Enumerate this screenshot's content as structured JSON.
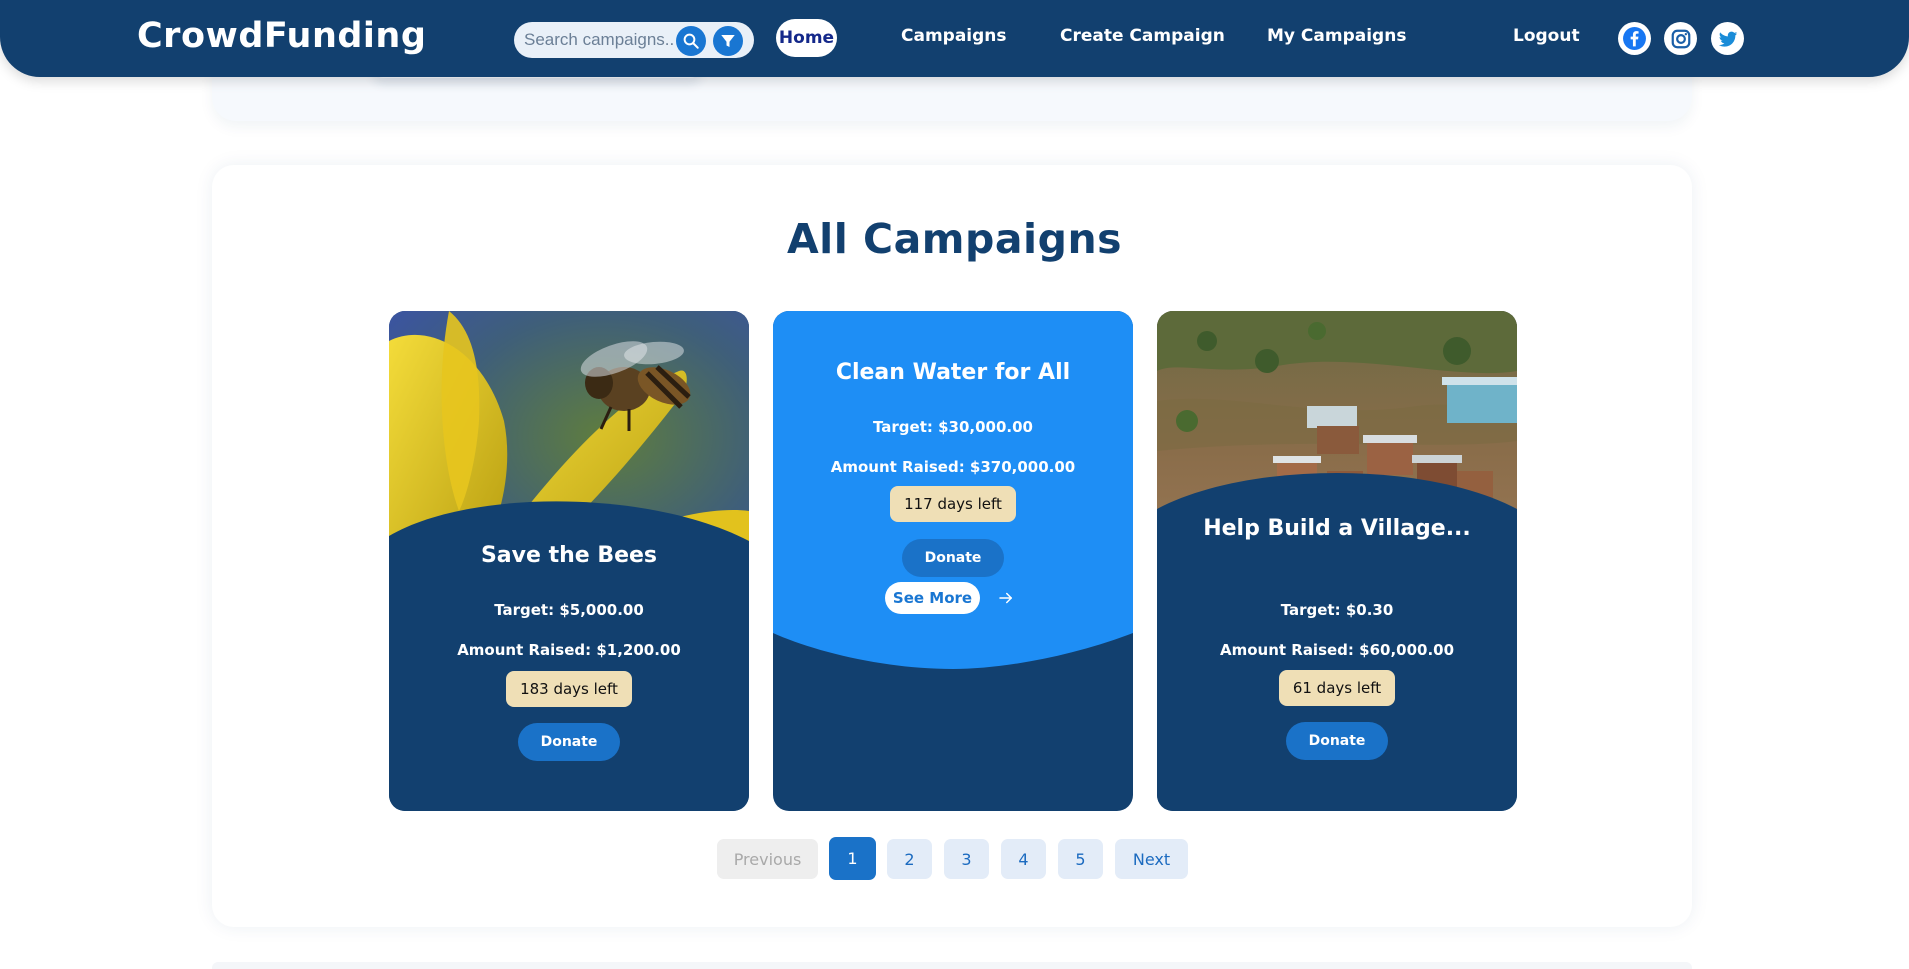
{
  "brand": "CrowdFunding",
  "search": {
    "placeholder": "Search campaigns..."
  },
  "nav": {
    "home": "Home",
    "campaigns": "Campaigns",
    "create": "Create Campaign",
    "my_campaigns": "My Campaigns",
    "logout": "Logout"
  },
  "social": [
    "facebook-icon",
    "instagram-icon",
    "twitter-icon"
  ],
  "section_title": "All Campaigns",
  "campaigns": [
    {
      "title": "Save the Bees",
      "target": "Target: $5,000.00",
      "raised": "Amount Raised: $1,200.00",
      "days": "183 days left",
      "donate": "Donate"
    },
    {
      "title": "Clean Water for All",
      "target": "Target: $30,000.00",
      "raised": "Amount Raised: $370,000.00",
      "days": "117 days left",
      "donate": "Donate",
      "see_more": "See More"
    },
    {
      "title": "Help Build a Village...",
      "target": "Target: $0.30",
      "raised": "Amount Raised: $60,000.00",
      "days": "61 days left",
      "donate": "Donate"
    }
  ],
  "pagination": {
    "previous": "Previous",
    "pages": [
      "1",
      "2",
      "3",
      "4",
      "5"
    ],
    "current": "1",
    "next": "Next"
  },
  "colors": {
    "navy": "#12406f",
    "accent_blue": "#1a72c8",
    "card_blue": "#1e8ef5",
    "badge": "#efdfb6"
  }
}
